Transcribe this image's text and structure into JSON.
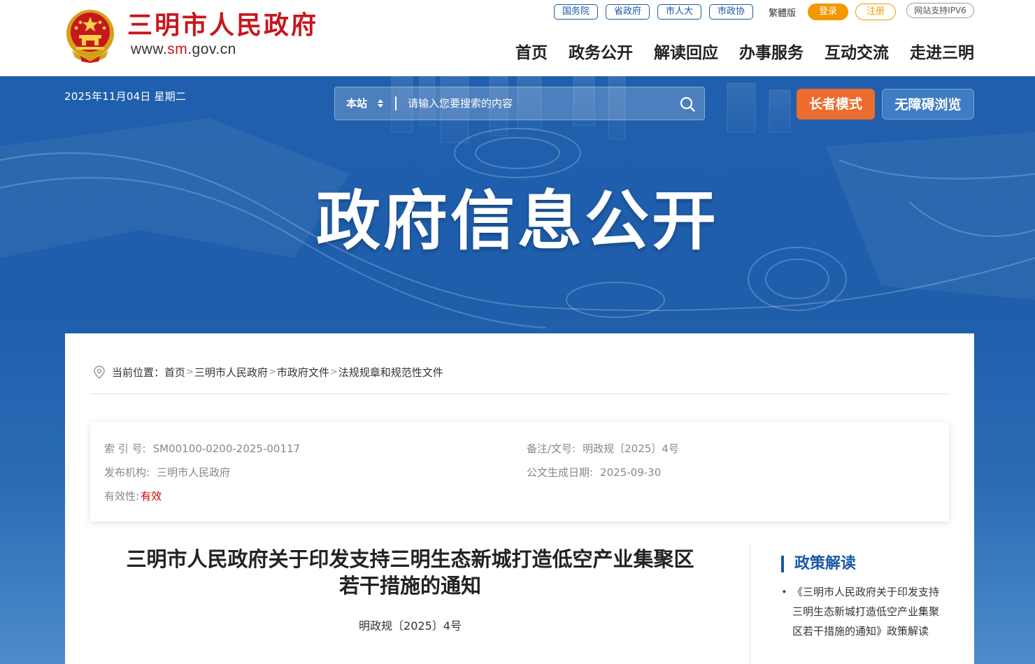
{
  "header": {
    "site_name": "三明市人民政府",
    "domain_prefix": "www.",
    "domain_highlight": "sm",
    "domain_suffix": ".gov.cn",
    "top_links": [
      "国务院",
      "省政府",
      "市人大",
      "市政协"
    ],
    "traditional": "繁體版",
    "login": "登录",
    "register": "注册",
    "ipv6": "网站支持IPV6",
    "nav": [
      "首页",
      "政务公开",
      "解读回应",
      "办事服务",
      "互动交流",
      "走进三明"
    ]
  },
  "banner": {
    "date": "2025年11月04日 星期二",
    "search_scope": "本站",
    "search_placeholder": "请输入您要搜索的内容",
    "elder_mode": "长者模式",
    "accessibility": "无障碍浏览",
    "title": "政府信息公开"
  },
  "breadcrumb": {
    "label": "当前位置：",
    "items": [
      "首页",
      "三明市人民政府",
      "市政府文件",
      "法规规章和规范性文件"
    ],
    "separator": ">"
  },
  "meta": {
    "index_label": "索 引 号:",
    "index_value": "SM00100-0200-2025-00117",
    "doc_no_label": "备注/文号:",
    "doc_no_value": "明政规〔2025〕4号",
    "org_label": "发布机构:",
    "org_value": "三明市人民政府",
    "date_label": "公文生成日期:",
    "date_value": "2025-09-30",
    "validity_label": "有效性:",
    "validity_value": "有效"
  },
  "document": {
    "title_line1": "三明市人民政府关于印发支持三明生态新城打造低空产业集聚区",
    "title_line2": "若干措施的通知",
    "number": "明政规〔2025〕4号"
  },
  "sidebar": {
    "title": "政策解读",
    "items": [
      "《三明市人民政府关于印发支持三明生态新城打造低空产业集聚区若干措施的通知》政策解读"
    ]
  },
  "colors": {
    "brand_red": "#c8161d",
    "brand_blue": "#1a57a8",
    "orange": "#f39800",
    "elder_orange": "#eb6c2d",
    "validity_red": "#d10000"
  }
}
